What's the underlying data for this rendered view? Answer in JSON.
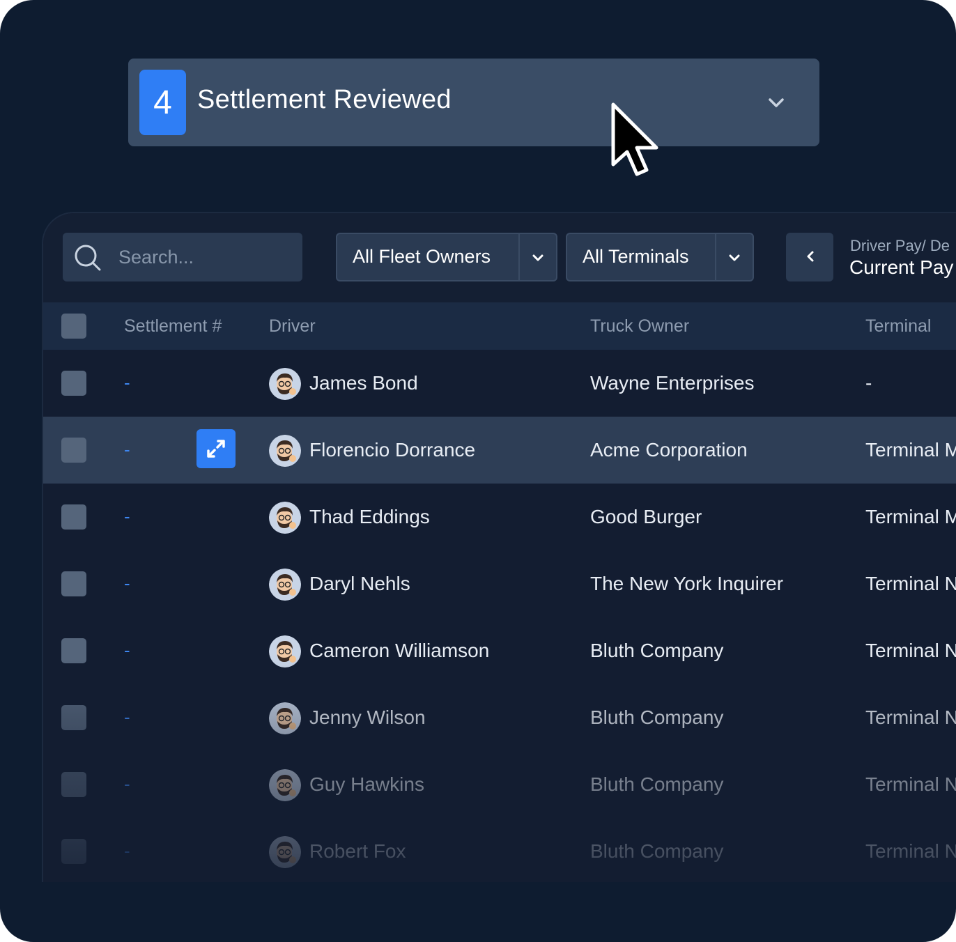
{
  "status": {
    "number": "4",
    "label": "Settlement Reviewed"
  },
  "toolbar": {
    "search_placeholder": "Search...",
    "fleet_filter": "All Fleet Owners",
    "terminal_filter": "All Terminals",
    "period_label": "Driver Pay/ De",
    "period_value": "Current Pay"
  },
  "table": {
    "columns": [
      "Settlement #",
      "Driver",
      "Truck Owner",
      "Terminal"
    ],
    "rows": [
      {
        "settlement": "-",
        "driver": "James Bond",
        "owner": "Wayne Enterprises",
        "terminal": "-"
      },
      {
        "settlement": "-",
        "driver": "Florencio Dorrance",
        "owner": "Acme Corporation",
        "terminal": "Terminal M"
      },
      {
        "settlement": "-",
        "driver": "Thad Eddings",
        "owner": "Good Burger",
        "terminal": "Terminal M"
      },
      {
        "settlement": "-",
        "driver": "Daryl Nehls",
        "owner": "The New York Inquirer",
        "terminal": "Terminal N"
      },
      {
        "settlement": "-",
        "driver": "Cameron Williamson",
        "owner": "Bluth Company",
        "terminal": "Terminal N"
      },
      {
        "settlement": "-",
        "driver": "Jenny Wilson",
        "owner": "Bluth Company",
        "terminal": "Terminal N"
      },
      {
        "settlement": "-",
        "driver": "Guy Hawkins",
        "owner": "Bluth Company",
        "terminal": "Terminal N"
      },
      {
        "settlement": "-",
        "driver": "Robert Fox",
        "owner": "Bluth Company",
        "terminal": "Terminal N"
      }
    ]
  },
  "colors": {
    "background": "#0e1c30",
    "accent": "#2f7ef5",
    "highlight_row": "#2e3e56"
  }
}
